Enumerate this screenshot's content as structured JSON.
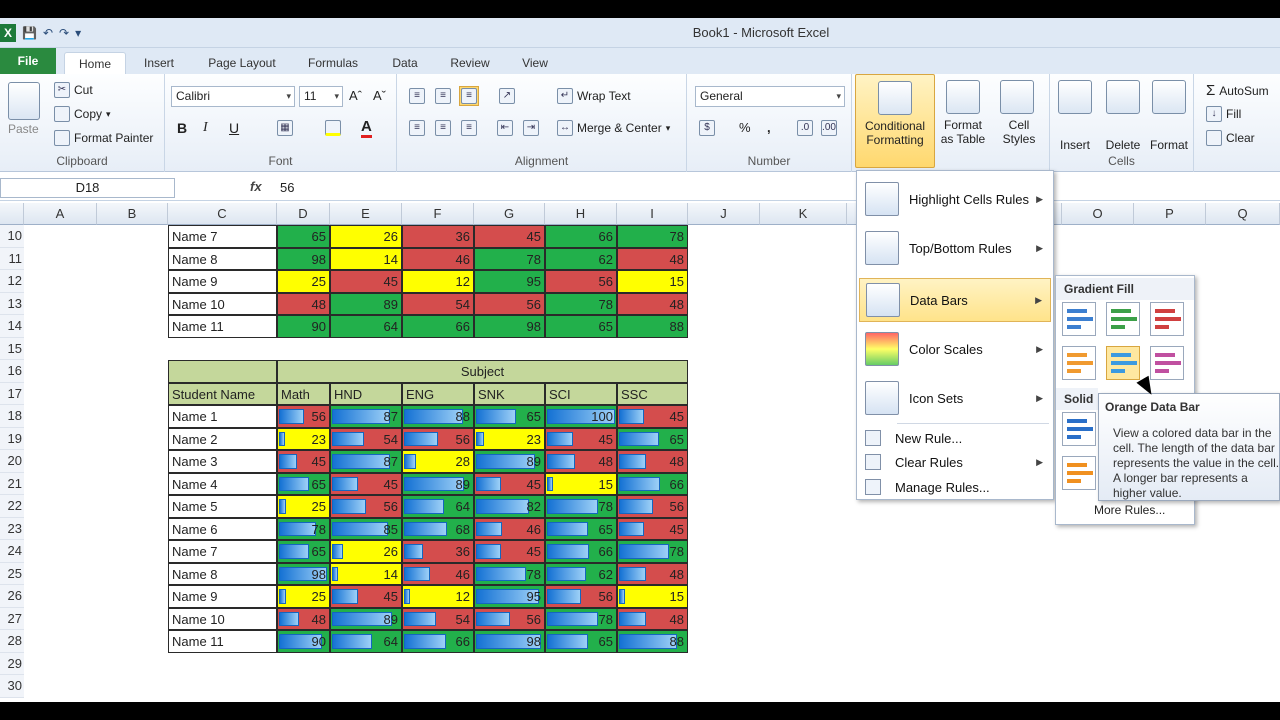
{
  "title": "Book1  -  Microsoft Excel",
  "tabs": [
    "File",
    "Home",
    "Insert",
    "Page Layout",
    "Formulas",
    "Data",
    "Review",
    "View"
  ],
  "clipboard": {
    "paste": "Paste",
    "cut": "Cut",
    "copy": "Copy",
    "format_painter": "Format Painter",
    "label": "Clipboard"
  },
  "font": {
    "name": "Calibri",
    "size": "11",
    "label": "Font",
    "bold": "B",
    "italic": "I",
    "underline": "U"
  },
  "alignment": {
    "wrap": "Wrap Text",
    "merge": "Merge & Center",
    "label": "Alignment"
  },
  "number": {
    "format": "General",
    "label": "Number",
    "percent": "%",
    "comma": ","
  },
  "styles": {
    "cf": "Conditional Formatting",
    "fat": "Format as Table",
    "cs": "Cell Styles"
  },
  "cells": {
    "insert": "Insert",
    "delete": "Delete",
    "format": "Format",
    "label": "Cells"
  },
  "editing": {
    "autosum": "AutoSum",
    "fill": "Fill",
    "clear": "Clear"
  },
  "formula": {
    "namebox": "D18",
    "fx": "fx",
    "value": "56"
  },
  "columns": [
    "A",
    "B",
    "C",
    "D",
    "E",
    "F",
    "G",
    "H",
    "I",
    "J",
    "K",
    "",
    "",
    "O",
    "P",
    "Q"
  ],
  "rows": [
    "10",
    "11",
    "12",
    "13",
    "14",
    "15",
    "16",
    "17",
    "18",
    "19",
    "20",
    "21",
    "22",
    "23",
    "24",
    "25",
    "26",
    "27",
    "28",
    "29",
    "30"
  ],
  "table1": [
    {
      "name": "Name 7",
      "vals": [
        "65",
        "26",
        "36",
        "45",
        "66",
        "78"
      ]
    },
    {
      "name": "Name 8",
      "vals": [
        "98",
        "14",
        "46",
        "78",
        "62",
        "48"
      ]
    },
    {
      "name": "Name 9",
      "vals": [
        "25",
        "45",
        "12",
        "95",
        "56",
        "15"
      ]
    },
    {
      "name": "Name 10",
      "vals": [
        "48",
        "89",
        "54",
        "56",
        "78",
        "48"
      ]
    },
    {
      "name": "Name 11",
      "vals": [
        "90",
        "64",
        "66",
        "98",
        "65",
        "88"
      ]
    }
  ],
  "table2": {
    "subject": "Subject",
    "headers": [
      "Student Name",
      "Math",
      "HND",
      "ENG",
      "SNK",
      "SCI",
      "SSC"
    ],
    "rows": [
      {
        "name": "Name 1",
        "vals": [
          "56",
          "87",
          "88",
          "65",
          "100",
          "45"
        ]
      },
      {
        "name": "Name 2",
        "vals": [
          "23",
          "54",
          "56",
          "23",
          "45",
          "65"
        ]
      },
      {
        "name": "Name 3",
        "vals": [
          "45",
          "87",
          "28",
          "89",
          "48",
          "48"
        ]
      },
      {
        "name": "Name 4",
        "vals": [
          "65",
          "45",
          "89",
          "45",
          "15",
          "66"
        ]
      },
      {
        "name": "Name 5",
        "vals": [
          "25",
          "56",
          "64",
          "82",
          "78",
          "56"
        ]
      },
      {
        "name": "Name 6",
        "vals": [
          "78",
          "85",
          "68",
          "46",
          "65",
          "45"
        ]
      },
      {
        "name": "Name 7",
        "vals": [
          "65",
          "26",
          "36",
          "45",
          "66",
          "78"
        ]
      },
      {
        "name": "Name 8",
        "vals": [
          "98",
          "14",
          "46",
          "78",
          "62",
          "48"
        ]
      },
      {
        "name": "Name 9",
        "vals": [
          "25",
          "45",
          "12",
          "95",
          "56",
          "15"
        ]
      },
      {
        "name": "Name 10",
        "vals": [
          "48",
          "89",
          "54",
          "56",
          "78",
          "48"
        ]
      },
      {
        "name": "Name 11",
        "vals": [
          "90",
          "64",
          "66",
          "98",
          "65",
          "88"
        ]
      }
    ]
  },
  "menu": {
    "highlight": "Highlight Cells Rules",
    "topbottom": "Top/Bottom Rules",
    "databars": "Data Bars",
    "colorscales": "Color Scales",
    "iconsets": "Icon Sets",
    "newrule": "New Rule...",
    "clearrules": "Clear Rules",
    "manage": "Manage Rules..."
  },
  "submenu": {
    "gradient": "Gradient Fill",
    "solid": "Solid",
    "more": "More Rules..."
  },
  "tooltip": {
    "title": "Orange Data Bar",
    "desc": "View a colored data bar in the cell. The length of the data bar represents the value in the cell. A longer bar represents a higher value."
  },
  "colors": {
    "green": "#22b04b",
    "yellow": "#ffff00",
    "red": "#d44d4d",
    "header": "#c4d79b"
  }
}
